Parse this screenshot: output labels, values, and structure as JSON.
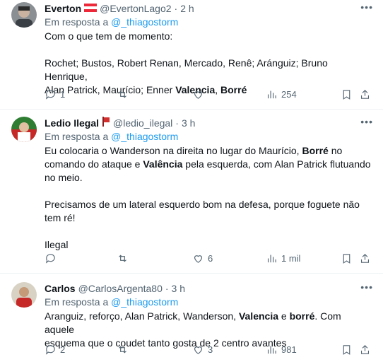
{
  "reply_prefix": "Em resposta a",
  "tweets": [
    {
      "name": "Everton",
      "handle": "@EvertonLago2",
      "time": "2 h",
      "mention": "@_thiagostorm",
      "line1": "Com o que tem de momento:",
      "line2": "Rochet; Bustos, Robert Renan, Mercado, Renê; Aránguiz; Bruno Henrique,",
      "line3a": "Alan Patrick, Maurício; Enner ",
      "line3b": "Valencia",
      "line3c": ", ",
      "line3d": "Borré",
      "replies": "1",
      "retweets": "",
      "likes": "",
      "views": "254"
    },
    {
      "name": "Ledio Ilegal",
      "handle": "@ledio_ilegal",
      "time": "3 h",
      "mention": "@_thiagostorm",
      "p1a": "Eu colocaria o Wanderson na direita no lugar do Maurício, ",
      "p1b": "Borré",
      "p1c": " no",
      "p1d": "comando do ataque e ",
      "p1e": "Valência",
      "p1f": " pela esquerda, com Alan Patrick flutuando",
      "p1g": "no meio.",
      "p2a": "Precisamos de um lateral esquerdo bom na defesa, porque foguete não",
      "p2b": "tem ré!",
      "p3": "Ilegal",
      "replies": "",
      "retweets": "",
      "likes": "6",
      "views": "1 mil"
    },
    {
      "name": "Carlos",
      "handle": "@CarlosArgenta80",
      "time": "3 h",
      "mention": "@_thiagostorm",
      "l1a": "Aranguiz, reforço, Alan Patrick, Wanderson, ",
      "l1b": "Valencia",
      "l1c": " e ",
      "l1d": "borré",
      "l1e": ". Com aquele",
      "l2": "esquema que o coudet tanto gosta de 2 centro avantes",
      "replies": "2",
      "retweets": "",
      "likes": "3",
      "views": "981"
    }
  ],
  "colors": {
    "link": "#1d9bf0",
    "muted": "#536471",
    "text": "#0f1419"
  },
  "icons": [
    "reply-icon",
    "retweet-icon",
    "like-icon",
    "views-icon",
    "bookmark-icon",
    "share-icon",
    "more-icon"
  ]
}
